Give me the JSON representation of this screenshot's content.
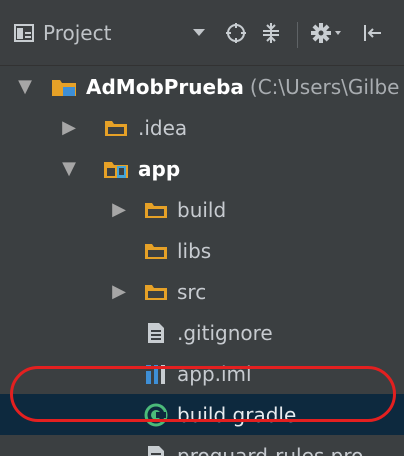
{
  "toolbar": {
    "view_name": "Project",
    "icons": [
      "project-window-icon",
      "dropdown-arrow-icon",
      "locate-icon",
      "collapse-all-icon",
      "settings-icon",
      "hide-panel-icon"
    ]
  },
  "tree": {
    "root": {
      "name": "AdMobPrueba",
      "path": "(C:\\Users\\Gilbe",
      "expanded": true,
      "icon": "project-folder-icon"
    },
    "items": [
      {
        "label": "AdMobPrueba",
        "path": "(C:\\Users\\Gilbe",
        "type": "project",
        "expanded": true
      },
      {
        "label": ".idea",
        "type": "folder",
        "expanded": false
      },
      {
        "label": "app",
        "type": "module",
        "expanded": true
      },
      {
        "label": "build",
        "type": "folder",
        "expanded": false
      },
      {
        "label": "libs",
        "type": "folder",
        "expanded": null
      },
      {
        "label": "src",
        "type": "folder",
        "expanded": false
      },
      {
        "label": ".gitignore",
        "type": "file"
      },
      {
        "label": "app.iml",
        "type": "iml"
      },
      {
        "label": "build.gradle",
        "type": "gradle",
        "selected": true
      },
      {
        "label": "proguard-rules.pro",
        "type": "file"
      }
    ]
  },
  "colors": {
    "panel_bg": "#3c3f41",
    "selected_bg": "#0d293e",
    "folder_orange": "#e6a127",
    "gradle_green": "#4bba7a",
    "iml_blue": "#3e8fd6",
    "highlight_red": "#e32020"
  }
}
